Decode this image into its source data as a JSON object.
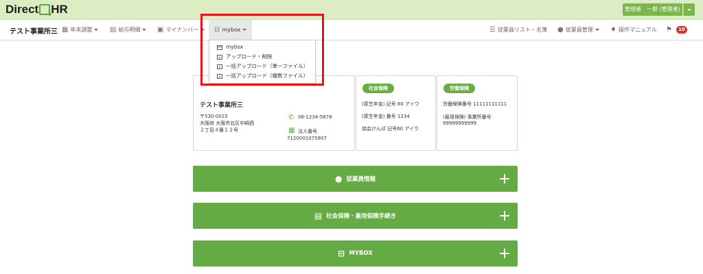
{
  "header": {
    "logo_left": "Direct",
    "logo_right": "HR",
    "user_label": "管理者　一郎 (管理者)"
  },
  "nav": {
    "office": "テスト事業所三",
    "items": [
      {
        "label": "年末調整",
        "icon": "calendar-icon"
      },
      {
        "label": "給与明細",
        "icon": "document-icon"
      },
      {
        "label": "マイナンバー",
        "icon": "id-card-icon"
      },
      {
        "label": "mybox",
        "icon": "box-icon"
      }
    ],
    "right_items": [
      {
        "label": "従業員リスト・名簿",
        "icon": "list-icon"
      },
      {
        "label": "従業員管理",
        "icon": "user-icon"
      },
      {
        "label": "操作マニュアル",
        "icon": "bulb-icon"
      }
    ],
    "notification_count": "10"
  },
  "dropdown": {
    "items": [
      {
        "label": "mybox",
        "icon": "box-icon"
      },
      {
        "label": "アップロード・削除",
        "icon": "upload-icon"
      },
      {
        "label": "一括アップロード（単一ファイル）",
        "icon": "upload-icon"
      },
      {
        "label": "一括アップロード（複数ファイル）",
        "icon": "upload-icon"
      }
    ]
  },
  "cards": {
    "office": {
      "name": "テスト事業所三",
      "zip": "〒530-0015",
      "address1": "大阪府 大阪市北区中崎西",
      "address2": "２丁目４番１２号",
      "phone": "06-1234-5678",
      "corp_label": "法人番号",
      "corp_number": "7120001075907"
    },
    "social": {
      "title": "社会保険",
      "line1": "(厚生年金) 記号 60 アイウ",
      "line2": "(厚生年金) 番号 1234",
      "line3": "協会けんぽ 記号60 アイウ"
    },
    "labor": {
      "title": "労働保険",
      "line1": "労働保険番号 11111111111",
      "line2": "(雇用保険) 事業所番号",
      "line3": "99999999999"
    }
  },
  "bars": [
    {
      "label": "従業員情報",
      "icon": "user-icon"
    },
    {
      "label": "社会保険・雇用保険手続き",
      "icon": "document-icon"
    },
    {
      "label": "MYBOX",
      "icon": "box-icon"
    }
  ],
  "colors": {
    "brand_green": "#65ab43",
    "topbar_bg": "#dcedc4",
    "highlight": "#e8111a",
    "badge": "#d9312d"
  }
}
